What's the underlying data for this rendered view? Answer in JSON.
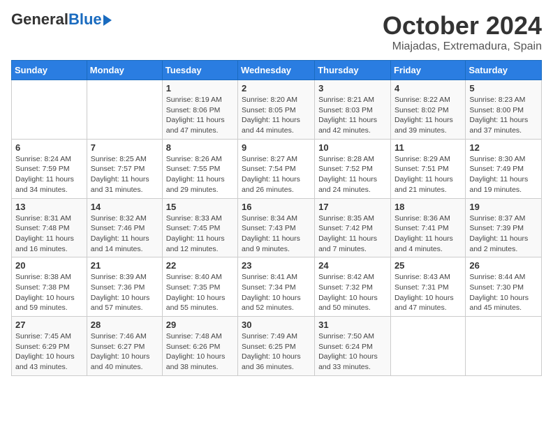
{
  "header": {
    "logo_general": "General",
    "logo_blue": "Blue",
    "title": "October 2024",
    "subtitle": "Miajadas, Extremadura, Spain"
  },
  "calendar": {
    "days_of_week": [
      "Sunday",
      "Monday",
      "Tuesday",
      "Wednesday",
      "Thursday",
      "Friday",
      "Saturday"
    ],
    "weeks": [
      [
        {
          "day": "",
          "info": ""
        },
        {
          "day": "",
          "info": ""
        },
        {
          "day": "1",
          "info": "Sunrise: 8:19 AM\nSunset: 8:06 PM\nDaylight: 11 hours and 47 minutes."
        },
        {
          "day": "2",
          "info": "Sunrise: 8:20 AM\nSunset: 8:05 PM\nDaylight: 11 hours and 44 minutes."
        },
        {
          "day": "3",
          "info": "Sunrise: 8:21 AM\nSunset: 8:03 PM\nDaylight: 11 hours and 42 minutes."
        },
        {
          "day": "4",
          "info": "Sunrise: 8:22 AM\nSunset: 8:02 PM\nDaylight: 11 hours and 39 minutes."
        },
        {
          "day": "5",
          "info": "Sunrise: 8:23 AM\nSunset: 8:00 PM\nDaylight: 11 hours and 37 minutes."
        }
      ],
      [
        {
          "day": "6",
          "info": "Sunrise: 8:24 AM\nSunset: 7:59 PM\nDaylight: 11 hours and 34 minutes."
        },
        {
          "day": "7",
          "info": "Sunrise: 8:25 AM\nSunset: 7:57 PM\nDaylight: 11 hours and 31 minutes."
        },
        {
          "day": "8",
          "info": "Sunrise: 8:26 AM\nSunset: 7:55 PM\nDaylight: 11 hours and 29 minutes."
        },
        {
          "day": "9",
          "info": "Sunrise: 8:27 AM\nSunset: 7:54 PM\nDaylight: 11 hours and 26 minutes."
        },
        {
          "day": "10",
          "info": "Sunrise: 8:28 AM\nSunset: 7:52 PM\nDaylight: 11 hours and 24 minutes."
        },
        {
          "day": "11",
          "info": "Sunrise: 8:29 AM\nSunset: 7:51 PM\nDaylight: 11 hours and 21 minutes."
        },
        {
          "day": "12",
          "info": "Sunrise: 8:30 AM\nSunset: 7:49 PM\nDaylight: 11 hours and 19 minutes."
        }
      ],
      [
        {
          "day": "13",
          "info": "Sunrise: 8:31 AM\nSunset: 7:48 PM\nDaylight: 11 hours and 16 minutes."
        },
        {
          "day": "14",
          "info": "Sunrise: 8:32 AM\nSunset: 7:46 PM\nDaylight: 11 hours and 14 minutes."
        },
        {
          "day": "15",
          "info": "Sunrise: 8:33 AM\nSunset: 7:45 PM\nDaylight: 11 hours and 12 minutes."
        },
        {
          "day": "16",
          "info": "Sunrise: 8:34 AM\nSunset: 7:43 PM\nDaylight: 11 hours and 9 minutes."
        },
        {
          "day": "17",
          "info": "Sunrise: 8:35 AM\nSunset: 7:42 PM\nDaylight: 11 hours and 7 minutes."
        },
        {
          "day": "18",
          "info": "Sunrise: 8:36 AM\nSunset: 7:41 PM\nDaylight: 11 hours and 4 minutes."
        },
        {
          "day": "19",
          "info": "Sunrise: 8:37 AM\nSunset: 7:39 PM\nDaylight: 11 hours and 2 minutes."
        }
      ],
      [
        {
          "day": "20",
          "info": "Sunrise: 8:38 AM\nSunset: 7:38 PM\nDaylight: 10 hours and 59 minutes."
        },
        {
          "day": "21",
          "info": "Sunrise: 8:39 AM\nSunset: 7:36 PM\nDaylight: 10 hours and 57 minutes."
        },
        {
          "day": "22",
          "info": "Sunrise: 8:40 AM\nSunset: 7:35 PM\nDaylight: 10 hours and 55 minutes."
        },
        {
          "day": "23",
          "info": "Sunrise: 8:41 AM\nSunset: 7:34 PM\nDaylight: 10 hours and 52 minutes."
        },
        {
          "day": "24",
          "info": "Sunrise: 8:42 AM\nSunset: 7:32 PM\nDaylight: 10 hours and 50 minutes."
        },
        {
          "day": "25",
          "info": "Sunrise: 8:43 AM\nSunset: 7:31 PM\nDaylight: 10 hours and 47 minutes."
        },
        {
          "day": "26",
          "info": "Sunrise: 8:44 AM\nSunset: 7:30 PM\nDaylight: 10 hours and 45 minutes."
        }
      ],
      [
        {
          "day": "27",
          "info": "Sunrise: 7:45 AM\nSunset: 6:29 PM\nDaylight: 10 hours and 43 minutes."
        },
        {
          "day": "28",
          "info": "Sunrise: 7:46 AM\nSunset: 6:27 PM\nDaylight: 10 hours and 40 minutes."
        },
        {
          "day": "29",
          "info": "Sunrise: 7:48 AM\nSunset: 6:26 PM\nDaylight: 10 hours and 38 minutes."
        },
        {
          "day": "30",
          "info": "Sunrise: 7:49 AM\nSunset: 6:25 PM\nDaylight: 10 hours and 36 minutes."
        },
        {
          "day": "31",
          "info": "Sunrise: 7:50 AM\nSunset: 6:24 PM\nDaylight: 10 hours and 33 minutes."
        },
        {
          "day": "",
          "info": ""
        },
        {
          "day": "",
          "info": ""
        }
      ]
    ]
  }
}
